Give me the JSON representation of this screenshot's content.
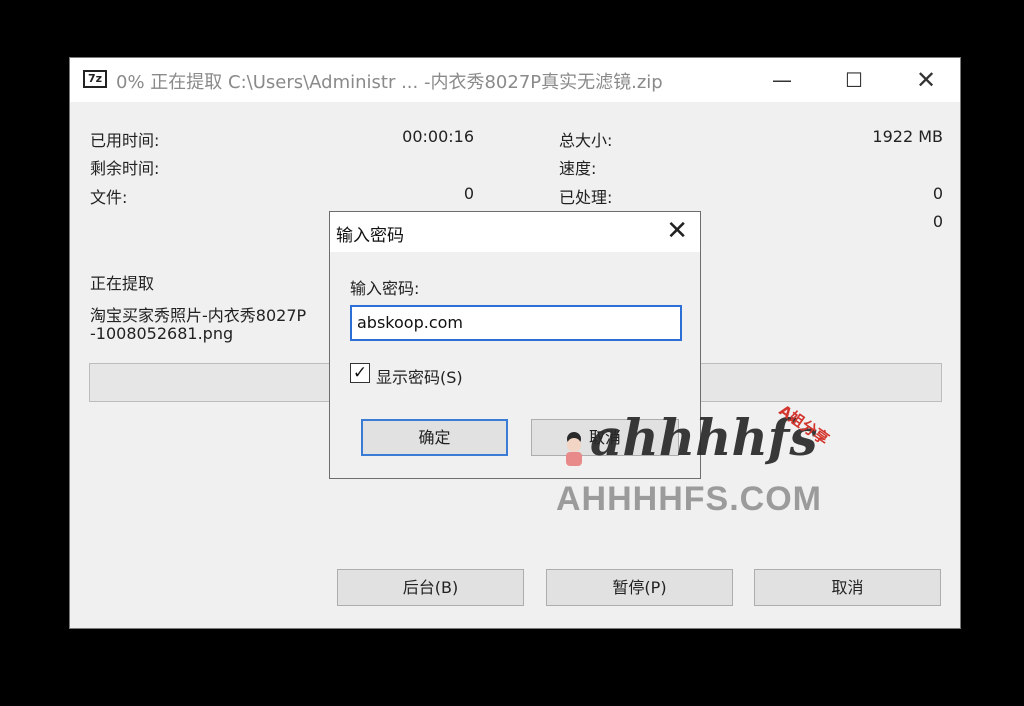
{
  "window": {
    "app_icon": "7z",
    "title": "0% 正在提取 C:\\Users\\Administr ... -内衣秀8027P真实无滤镜.zip",
    "controls": {
      "minimize": "—",
      "maximize": "☐",
      "close": "✕"
    }
  },
  "stats": {
    "elapsed_label": "已用时间:",
    "elapsed_value": "00:00:16",
    "remaining_label": "剩余时间:",
    "files_label": "文件:",
    "files_value": "0",
    "total_size_label": "总大小:",
    "total_size_value": "1922 MB",
    "speed_label": "速度:",
    "processed_label": "已处理:",
    "processed_value": "0",
    "extra_value": "0"
  },
  "extracting": {
    "heading": "正在提取",
    "file_line1": "淘宝买家秀照片-内衣秀8027P",
    "file_line2": "-1008052681.png"
  },
  "progress": {
    "fraction": 0
  },
  "buttons": {
    "background": "后台(B)",
    "pause": "暂停(P)",
    "cancel": "取消"
  },
  "dialog": {
    "title": "输入密码",
    "close": "✕",
    "prompt": "输入密码:",
    "password_value": "abskoop.com",
    "show_password_label": "显示密码(S)",
    "show_password_checked": true,
    "ok_label": "确定",
    "cancel_label": "取消"
  },
  "watermark": {
    "script_text": "ahhhhfs",
    "badge_text": "A姐分享",
    "domain_text": "AHHHHFS.COM"
  },
  "colors": {
    "accent": "#2b6fd6",
    "badge": "#d3342c"
  }
}
